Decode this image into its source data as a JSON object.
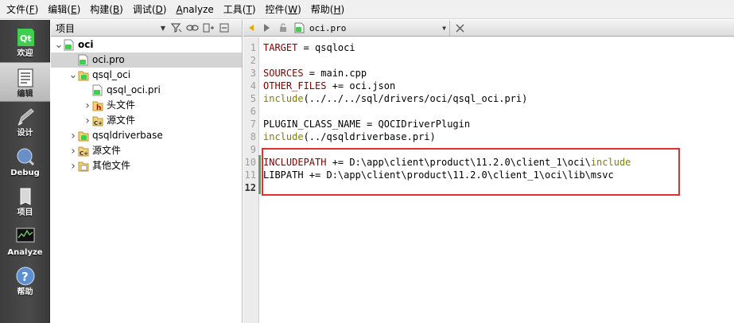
{
  "menu": [
    {
      "label": "文件(",
      "mn": "F",
      "end": ")"
    },
    {
      "label": "编辑(",
      "mn": "E",
      "end": ")"
    },
    {
      "label": "构建(",
      "mn": "B",
      "end": ")"
    },
    {
      "label": "调试(",
      "mn": "D",
      "end": ")"
    },
    {
      "label": "",
      "mn": "A",
      "end": "nalyze"
    },
    {
      "label": "工具(",
      "mn": "T",
      "end": ")"
    },
    {
      "label": "控件(",
      "mn": "W",
      "end": ")"
    },
    {
      "label": "帮助(",
      "mn": "H",
      "end": ")"
    }
  ],
  "modes": [
    {
      "label": "欢迎",
      "icon": "qt-logo-icon"
    },
    {
      "label": "编辑",
      "icon": "document-edit-icon",
      "active": true
    },
    {
      "label": "设计",
      "icon": "design-pencil-icon"
    },
    {
      "label": "Debug",
      "icon": "debug-bug-icon"
    },
    {
      "label": "项目",
      "icon": "project-wrench-icon"
    },
    {
      "label": "Analyze",
      "icon": "analyze-monitor-icon"
    },
    {
      "label": "帮助",
      "icon": "help-icon"
    }
  ],
  "project_pane": {
    "combo_label": "项目",
    "tree": [
      {
        "label": "oci",
        "depth": 0,
        "expanded": true,
        "icon": "pro-file-icon",
        "bold": true
      },
      {
        "label": "oci.pro",
        "depth": 1,
        "icon": "pro-file-icon",
        "selected": true
      },
      {
        "label": "qsql_oci",
        "depth": 1,
        "expanded": true,
        "icon": "pri-folder-icon"
      },
      {
        "label": "qsql_oci.pri",
        "depth": 2,
        "icon": "pro-file-icon"
      },
      {
        "label": "头文件",
        "depth": 2,
        "collapsed": true,
        "icon": "header-folder-icon"
      },
      {
        "label": "源文件",
        "depth": 2,
        "collapsed": true,
        "icon": "source-folder-icon"
      },
      {
        "label": "qsqldriverbase",
        "depth": 1,
        "collapsed": true,
        "icon": "pri-folder-icon"
      },
      {
        "label": "源文件",
        "depth": 1,
        "collapsed": true,
        "icon": "source-folder-icon"
      },
      {
        "label": "其他文件",
        "depth": 1,
        "collapsed": true,
        "icon": "other-folder-icon"
      }
    ]
  },
  "editor": {
    "file_name": "oci.pro",
    "current_line": 12,
    "lines": [
      [
        {
          "t": "TARGET",
          "c": "var"
        },
        {
          "t": " = qsqloci",
          "c": "txt"
        }
      ],
      [],
      [
        {
          "t": "SOURCES",
          "c": "var"
        },
        {
          "t": " = main.cpp",
          "c": "txt"
        }
      ],
      [
        {
          "t": "OTHER_FILES",
          "c": "var"
        },
        {
          "t": " += oci.json",
          "c": "txt"
        }
      ],
      [
        {
          "t": "include",
          "c": "kw"
        },
        {
          "t": "(../../../sql/drivers/oci/qsql_oci.pri)",
          "c": "txt"
        }
      ],
      [],
      [
        {
          "t": "PLUGIN_CLASS_NAME",
          "c": "txt"
        },
        {
          "t": " = QOCIDriverPlugin",
          "c": "txt"
        }
      ],
      [
        {
          "t": "include",
          "c": "kw"
        },
        {
          "t": "(../qsqldriverbase.pri)",
          "c": "txt"
        }
      ],
      [],
      [
        {
          "t": "INCLUDEPATH",
          "c": "var"
        },
        {
          "t": " += D:\\app\\client\\product\\11.2.0\\client_1\\oci\\",
          "c": "txt"
        },
        {
          "t": "include",
          "c": "kw"
        }
      ],
      [
        {
          "t": "LIBPATH",
          "c": "txt"
        },
        {
          "t": " += D:\\app\\client\\product\\11.2.0\\client_1\\oci\\lib\\msvc",
          "c": "txt"
        }
      ],
      []
    ]
  },
  "colors": {
    "variable": "#800000",
    "keyword": "#808000",
    "annotation_box": "#e03030"
  }
}
